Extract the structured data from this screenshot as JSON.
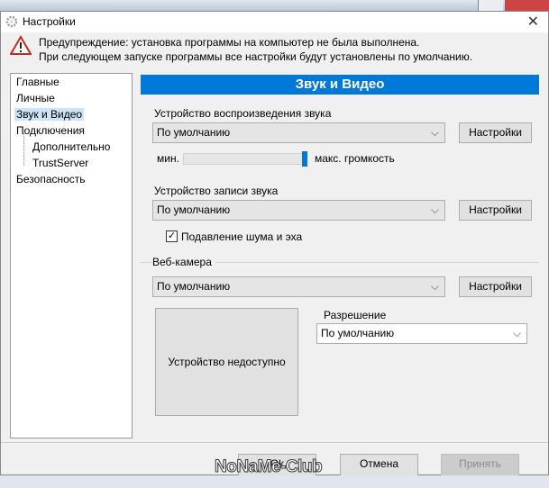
{
  "window": {
    "title": "Настройки",
    "close": "✕"
  },
  "warning": {
    "line1": "Предупреждение: установка программы на компьютер не была выполнена.",
    "line2": "При следующем запуске программы все настройки будут установлены по умолчанию."
  },
  "tree": [
    "Главные",
    "Личные",
    "Звук и Видео",
    "Подключения",
    "Дополнительно",
    "TrustServer",
    "Безопасность"
  ],
  "panel": {
    "title": "Звук и Видео",
    "playback": {
      "label": "Устройство воспроизведения звука",
      "value": "По умолчанию",
      "button": "Настройки"
    },
    "volume": {
      "min_label": "мин.",
      "max_label": "макс. громкость",
      "level": 1.0
    },
    "record": {
      "label": "Устройство записи звука",
      "value": "По умолчанию",
      "button": "Настройки"
    },
    "noise": {
      "label": "Подавление шума и эха",
      "checked": true,
      "mark": "✓"
    },
    "webcam": {
      "label": "Веб-камера",
      "value": "По умолчанию",
      "button": "Настройки",
      "preview": "Устройство недоступно",
      "res_label": "Разрешение",
      "res_value": "По умолчанию"
    }
  },
  "footer": {
    "ok": "Ok",
    "cancel": "Отмена",
    "apply": "Принять"
  },
  "watermark": "NoNaMe-Club",
  "chevron": "⌵"
}
